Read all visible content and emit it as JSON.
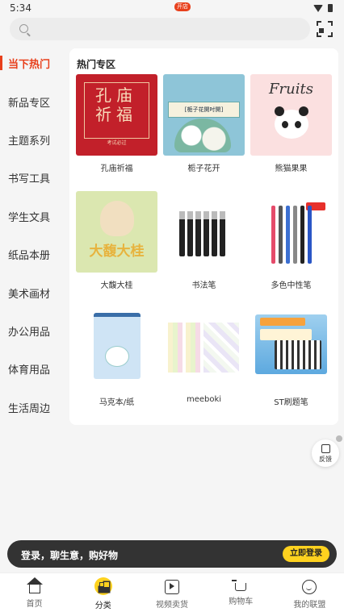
{
  "status_bar": {
    "time": "5:34"
  },
  "search": {
    "placeholder": ""
  },
  "sidebar": {
    "items": [
      {
        "label": "当下热门",
        "active": true
      },
      {
        "label": "新品专区"
      },
      {
        "label": "主题系列"
      },
      {
        "label": "书写工具"
      },
      {
        "label": "学生文具"
      },
      {
        "label": "纸品本册"
      },
      {
        "label": "美术画材"
      },
      {
        "label": "办公用品"
      },
      {
        "label": "体育用品"
      },
      {
        "label": "生活周边"
      }
    ]
  },
  "main": {
    "section_title": "热门专区",
    "products": [
      {
        "label": "孔庙祈福",
        "image_text": "孔庙祈福",
        "image_subtext": "考试必过"
      },
      {
        "label": "栀子花开",
        "image_text": "[栀子花開吋開]"
      },
      {
        "label": "熊猫果果",
        "image_text": "Fruits"
      },
      {
        "label": "大馥大桂",
        "image_text": "大馥大桂"
      },
      {
        "label": "书法笔"
      },
      {
        "label": "多色中性笔"
      },
      {
        "label": "马克本/纸"
      },
      {
        "label": "meeboki"
      },
      {
        "label": "ST刷题笔"
      }
    ]
  },
  "feedback": {
    "label": "反馈"
  },
  "login_bar": {
    "text": "登录，聊生意，购好物",
    "button": "立即登录"
  },
  "tabbar": {
    "items": [
      {
        "label": "首页",
        "icon": "home-icon"
      },
      {
        "label": "分类",
        "icon": "category-icon",
        "active": true
      },
      {
        "label": "视频卖货",
        "icon": "video-icon",
        "badge": "开店"
      },
      {
        "label": "购物车",
        "icon": "cart-icon"
      },
      {
        "label": "我的联盟",
        "icon": "profile-icon"
      }
    ]
  },
  "colors": {
    "accent": "#e8401c",
    "yellow": "#ffd21f",
    "dark_bar": "#333333"
  }
}
